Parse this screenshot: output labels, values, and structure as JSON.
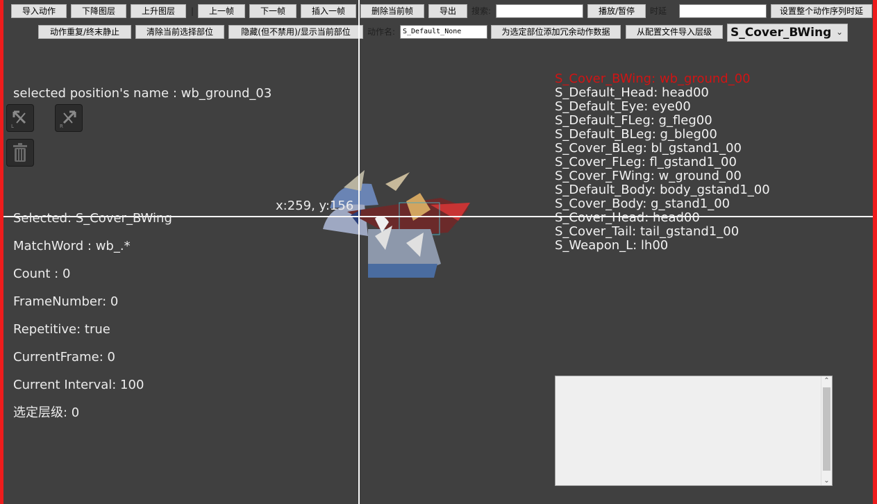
{
  "toolbar_row1": {
    "import_action": "导入动作",
    "layer_down": "下降图层",
    "layer_up": "上升图层",
    "separator": "|",
    "prev_frame": "上一帧",
    "next_frame": "下一帧",
    "insert_frame": "插入一帧",
    "delete_frame": "删除当前帧",
    "export": "导出",
    "search_label": "搜索:",
    "search_value": "",
    "play_pause": "播放/暂停",
    "delay_label": "时延",
    "delay_value": "",
    "set_sequence_delay": "设置整个动作序列时延"
  },
  "toolbar_row2": {
    "repeat_toggle": "动作重复/终末静止",
    "clear_selected_part": "清除当前选择部位",
    "hide_show_part": "隐藏(但不禁用)/显示当前部位",
    "action_name_label": "动作名:",
    "action_name_value": "S_Default_None",
    "add_redundant_data": "为选定部位添加冗余动作数据",
    "import_layer_from_config": "从配置文件导入层级",
    "part_select_value": "S_Cover_BWing"
  },
  "selected_position_label": "selected position's name : wb_ground_03",
  "tools": {
    "flip_left_icon": "flip-left-icon",
    "flip_right_icon": "flip-right-icon",
    "trash_icon": "trash-icon"
  },
  "crosshair_coord": "x:259, y:156",
  "info": {
    "selected": "Selected: S_Cover_BWing",
    "match_word": "MatchWord : wb_.*",
    "count": "Count : 0",
    "frame_number": "FrameNumber: 0",
    "repetitive": "Repetitive: true",
    "current_frame": "CurrentFrame: 0",
    "current_interval": "Current Interval: 100",
    "selected_layer": "选定层级: 0"
  },
  "parts": [
    {
      "text": "S_Cover_BWing: wb_ground_00",
      "selected": true
    },
    {
      "text": "S_Default_Head: head00",
      "selected": false
    },
    {
      "text": "S_Default_Eye: eye00",
      "selected": false
    },
    {
      "text": "S_Default_FLeg: g_fleg00",
      "selected": false
    },
    {
      "text": "S_Default_BLeg: g_bleg00",
      "selected": false
    },
    {
      "text": "S_Cover_BLeg: bl_gstand1_00",
      "selected": false
    },
    {
      "text": "S_Cover_FLeg: fl_gstand1_00",
      "selected": false
    },
    {
      "text": "S_Cover_FWing: w_ground_00",
      "selected": false
    },
    {
      "text": "S_Default_Body: body_gstand1_00",
      "selected": false
    },
    {
      "text": "S_Cover_Body: g_stand1_00",
      "selected": false
    },
    {
      "text": "S_Cover_Head: head00",
      "selected": false
    },
    {
      "text": "S_Cover_Tail: tail_gstand1_00",
      "selected": false
    },
    {
      "text": "S_Weapon_L: lh00",
      "selected": false
    }
  ],
  "log_text": "",
  "colors": {
    "window_border": "#ee1c1c",
    "canvas_bg": "#404040",
    "selected_part": "#d01414"
  }
}
